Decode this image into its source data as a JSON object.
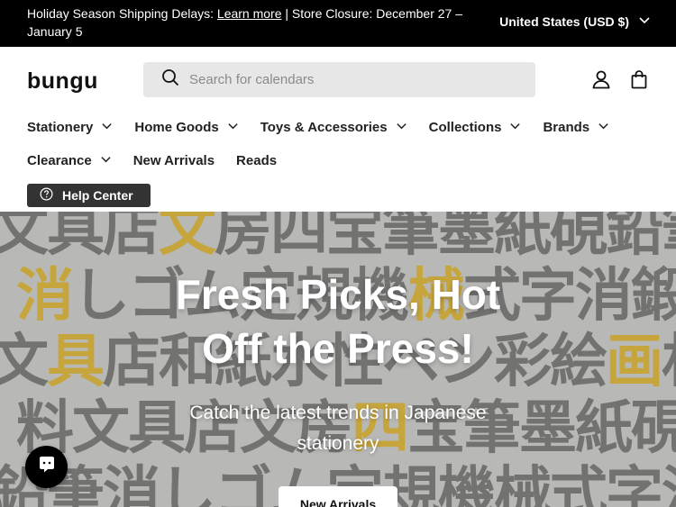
{
  "announcement": {
    "prefix": "Holiday Season Shipping Delays: ",
    "link": "Learn more",
    "suffix": " | Store Closure: December 27 – January 5"
  },
  "country_selector": {
    "label": "United States (USD $)",
    "icon": "chevron-down-icon"
  },
  "header": {
    "logo": "bungu",
    "search_placeholder": "Search for calendars",
    "icons": [
      "search-icon",
      "account-icon",
      "cart-icon"
    ]
  },
  "nav": {
    "row1": [
      {
        "label": "Stationery",
        "dropdown": true
      },
      {
        "label": "Home Goods",
        "dropdown": true
      },
      {
        "label": "Toys & Accessories",
        "dropdown": true
      },
      {
        "label": "Collections",
        "dropdown": true
      },
      {
        "label": "Brands",
        "dropdown": true
      }
    ],
    "row2": [
      {
        "label": "Clearance",
        "dropdown": true
      },
      {
        "label": "New Arrivals",
        "dropdown": false
      },
      {
        "label": "Reads",
        "dropdown": false
      }
    ]
  },
  "help_center": {
    "label": "Help Center",
    "icon": "question-circle-icon"
  },
  "hero": {
    "title_line1": "Fresh Picks, Hot",
    "title_line2": "Off the Press!",
    "subtitle": "Catch the latest trends in Japanese stationery",
    "button": "New Arrivals",
    "background_glyphs": "文具店文房四宝筆墨紙硯鉛筆消しゴム定規機械式字消鍛文具店和紙水性ペン彩絵画材料",
    "colors": {
      "ink": "#3a3a38",
      "gold": "#c9a227",
      "bg": "#b8b8b6"
    }
  },
  "chat_widget": {
    "icon": "chat-bubble-icon"
  },
  "colors": {
    "announce_bg": "#000000",
    "search_bg": "#e7e7e7",
    "help_bg": "#333333"
  }
}
